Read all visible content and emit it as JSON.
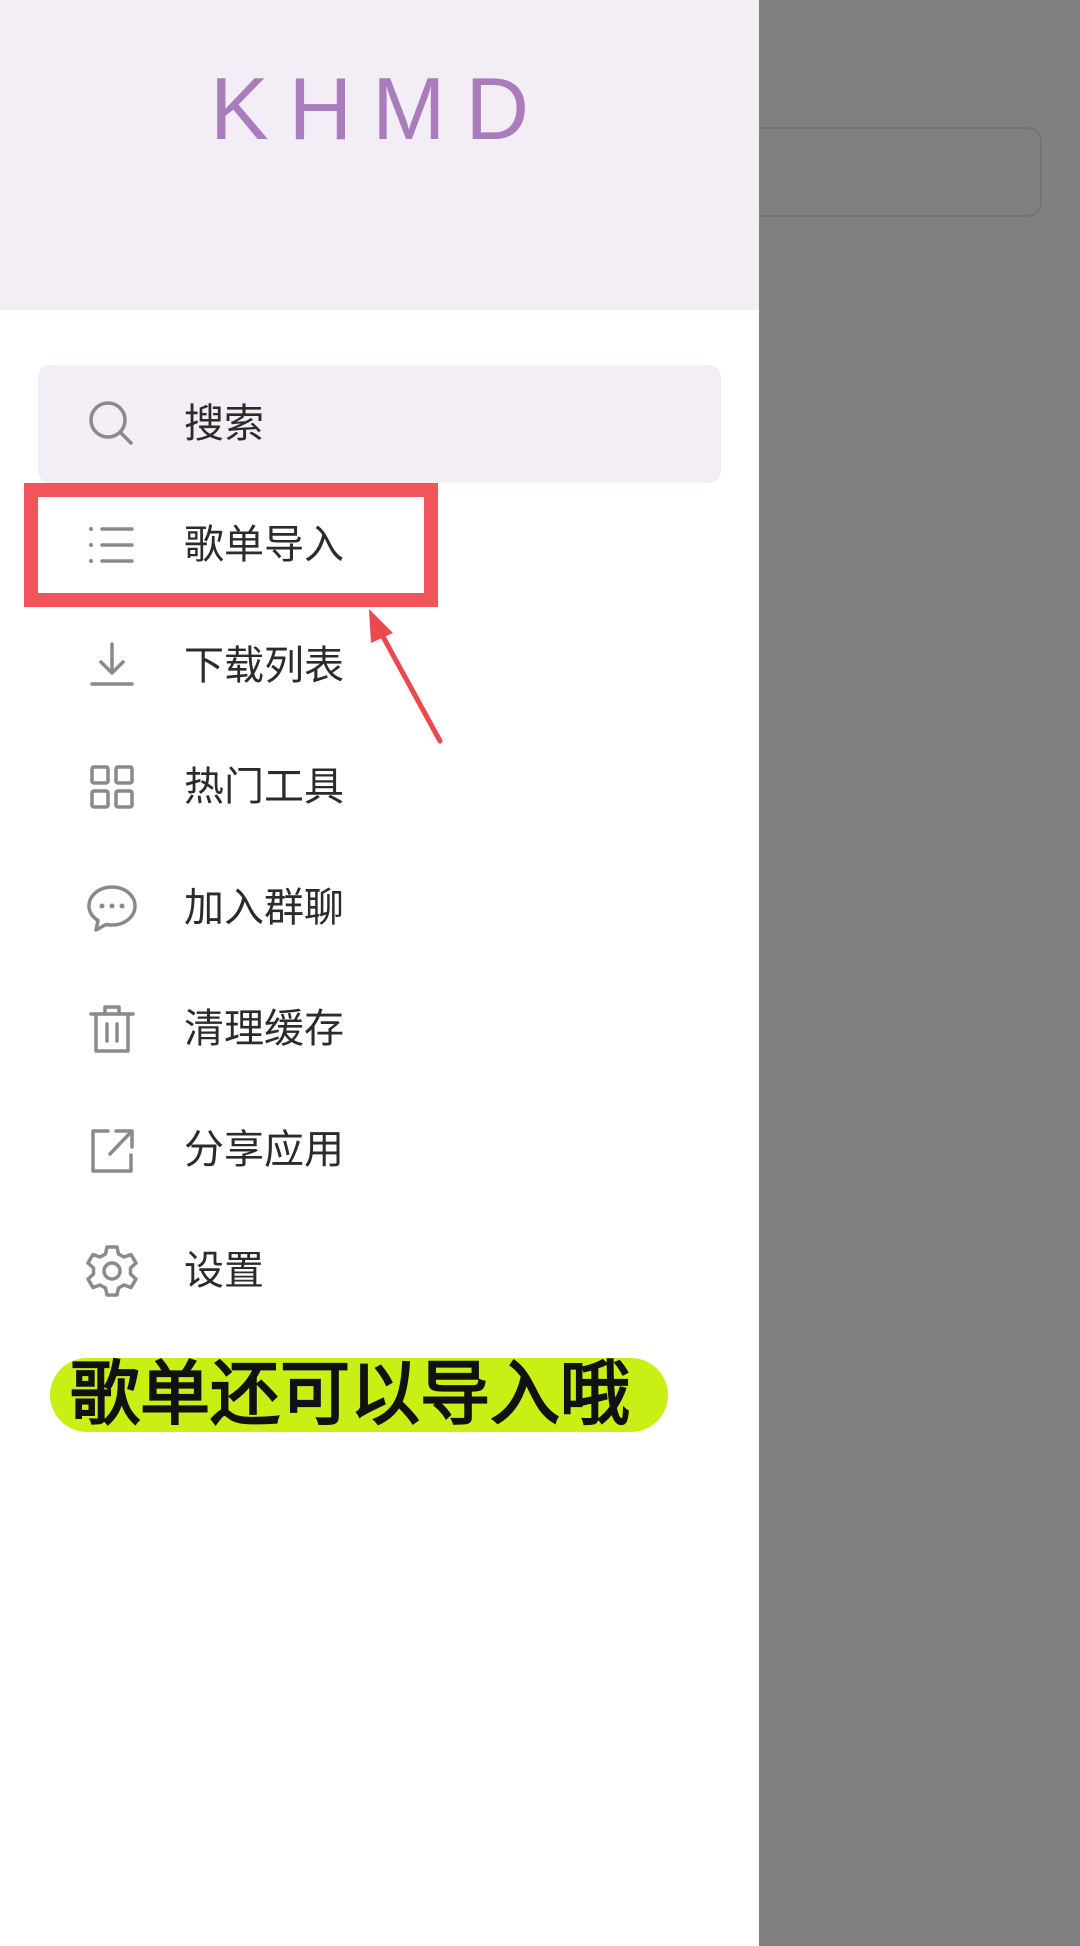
{
  "app": {
    "logo_text": "KHMD",
    "accent_color": "#a97cbd",
    "header_bg": "#f3edf5",
    "scrim_color": "#808080"
  },
  "menu": {
    "items": [
      {
        "label": "搜索",
        "icon": "search-icon",
        "active": true
      },
      {
        "label": "歌单导入",
        "icon": "list-icon"
      },
      {
        "label": "下载列表",
        "icon": "download-icon"
      },
      {
        "label": "热门工具",
        "icon": "grid-icon"
      },
      {
        "label": "加入群聊",
        "icon": "chat-icon"
      },
      {
        "label": "清理缓存",
        "icon": "trash-icon"
      },
      {
        "label": "分享应用",
        "icon": "share-icon"
      },
      {
        "label": "设置",
        "icon": "gear-icon"
      }
    ]
  },
  "annotation": {
    "caption": "歌单还可以导入哦",
    "highlight_color": "#f2545b",
    "caption_bg": "#c8f014"
  }
}
